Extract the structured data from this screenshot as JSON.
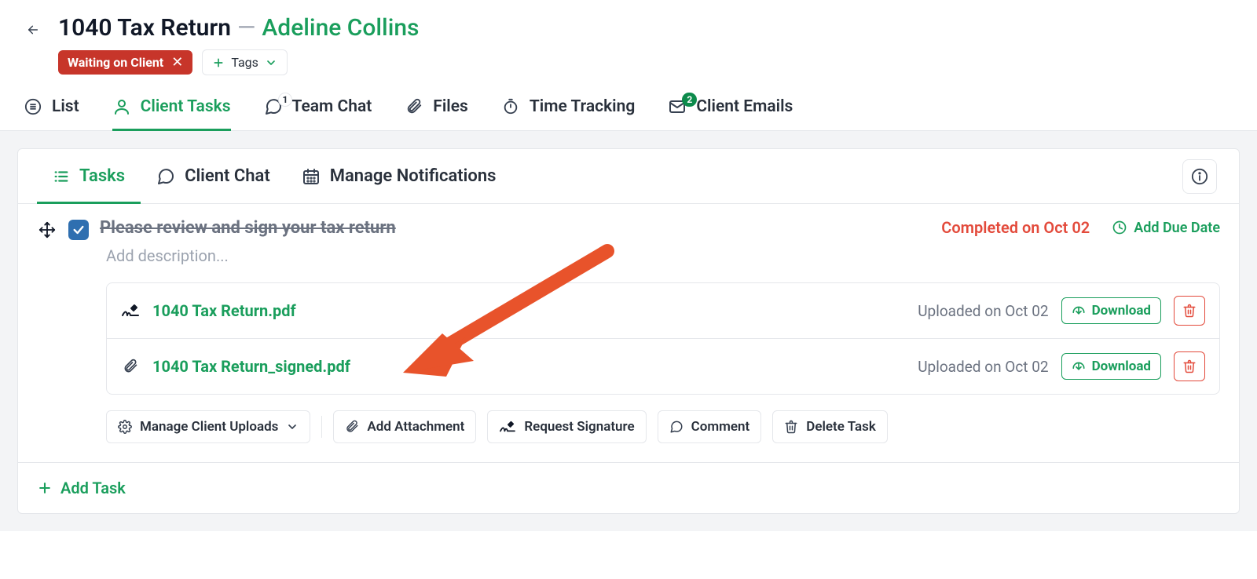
{
  "header": {
    "title": "1040 Tax Return",
    "separator": "—",
    "client": "Adeline Collins",
    "status_chip": "Waiting on Client",
    "tags_label": "Tags"
  },
  "main_tabs": {
    "list": "List",
    "client_tasks": "Client Tasks",
    "team_chat": "Team Chat",
    "team_chat_badge": "1",
    "files": "Files",
    "time_tracking": "Time Tracking",
    "client_emails": "Client Emails",
    "client_emails_badge": "2"
  },
  "sub_tabs": {
    "tasks": "Tasks",
    "client_chat": "Client Chat",
    "manage_notifications": "Manage Notifications"
  },
  "task": {
    "title": "Please review and sign your tax return",
    "description_placeholder": "Add description...",
    "completed_text": "Completed on Oct 02",
    "add_due_label": "Add Due Date"
  },
  "attachments": [
    {
      "name": "1040 Tax Return.pdf",
      "uploaded": "Uploaded on Oct 02",
      "download": "Download",
      "icon": "signature"
    },
    {
      "name": "1040 Tax Return_signed.pdf",
      "uploaded": "Uploaded on Oct 02",
      "download": "Download",
      "icon": "paperclip"
    }
  ],
  "actions": {
    "manage_uploads": "Manage Client Uploads",
    "add_attachment": "Add Attachment",
    "request_signature": "Request Signature",
    "comment": "Comment",
    "delete_task": "Delete Task"
  },
  "footer": {
    "add_task": "Add Task"
  }
}
